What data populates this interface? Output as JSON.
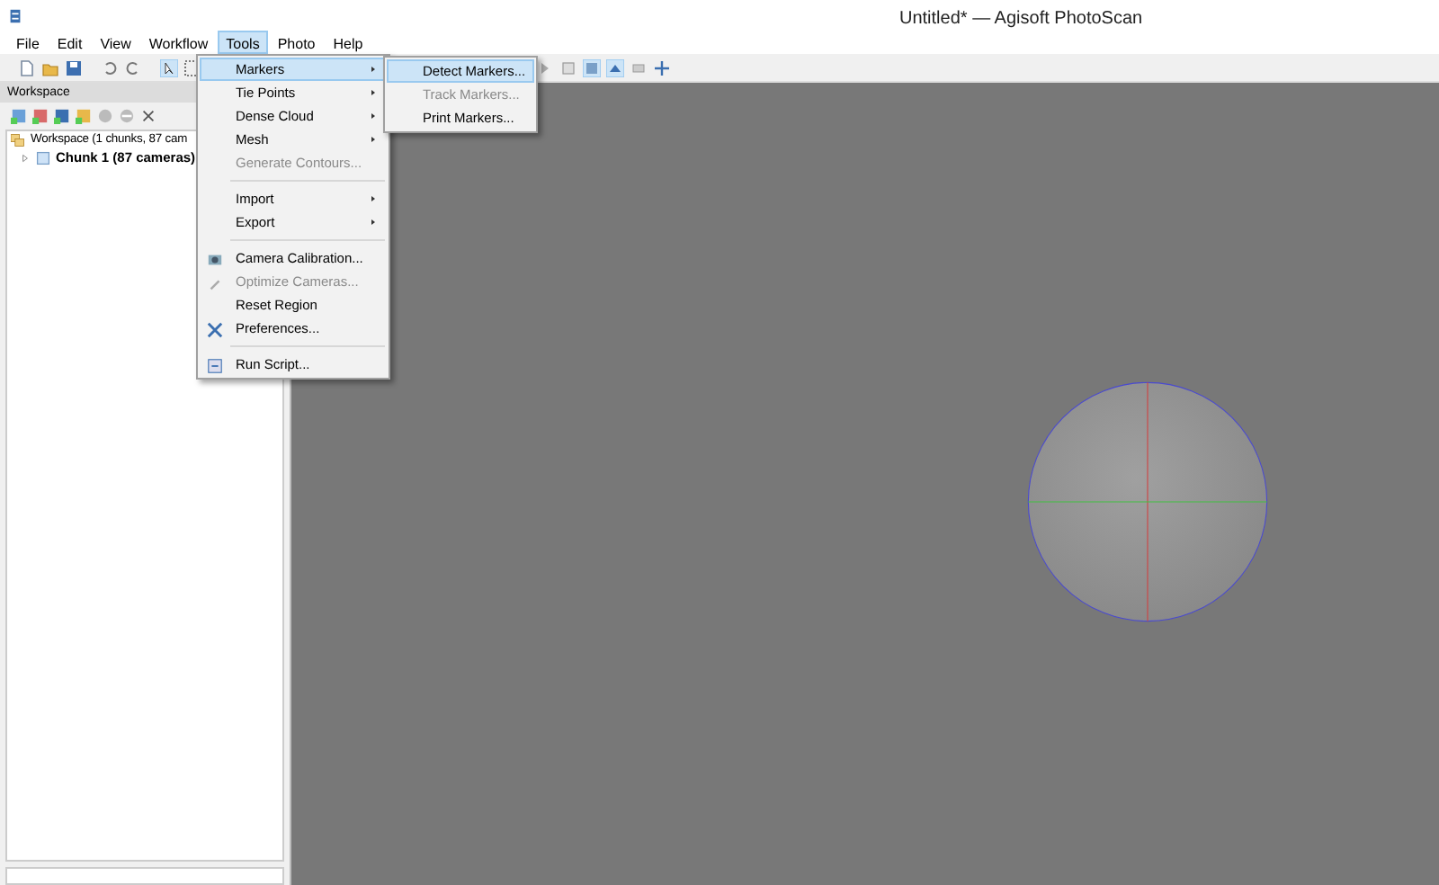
{
  "window": {
    "title": "Untitled* — Agisoft PhotoScan"
  },
  "menu_bar": [
    {
      "label": "File",
      "selected": false
    },
    {
      "label": "Edit",
      "selected": false
    },
    {
      "label": "View",
      "selected": false
    },
    {
      "label": "Workflow",
      "selected": false
    },
    {
      "label": "Tools",
      "selected": true
    },
    {
      "label": "Photo",
      "selected": false
    },
    {
      "label": "Help",
      "selected": false
    }
  ],
  "workspace": {
    "title": "Workspace",
    "tree": [
      {
        "label": "Workspace (1 chunks, 87 cam",
        "children": [
          {
            "label": "Chunk 1 (87 cameras)",
            "expanded": false
          }
        ]
      }
    ]
  },
  "tools_menu": [
    {
      "kind": "item",
      "label": "Markers",
      "submenu": true,
      "disabled": false,
      "selected": true
    },
    {
      "kind": "item",
      "label": "Tie Points",
      "submenu": true,
      "disabled": false,
      "selected": false
    },
    {
      "kind": "item",
      "label": "Dense Cloud",
      "submenu": true,
      "disabled": false,
      "selected": false
    },
    {
      "kind": "item",
      "label": "Mesh",
      "submenu": true,
      "disabled": false,
      "selected": false
    },
    {
      "kind": "item",
      "label": "Generate Contours...",
      "submenu": false,
      "disabled": true,
      "selected": false
    },
    {
      "kind": "separator"
    },
    {
      "kind": "item",
      "label": "Import",
      "submenu": true,
      "disabled": false,
      "selected": false
    },
    {
      "kind": "item",
      "label": "Export",
      "submenu": true,
      "disabled": false,
      "selected": false
    },
    {
      "kind": "separator"
    },
    {
      "kind": "item",
      "label": "Camera Calibration...",
      "submenu": false,
      "disabled": false,
      "selected": false
    },
    {
      "kind": "item",
      "label": "Optimize Cameras...",
      "submenu": false,
      "disabled": true,
      "selected": false
    },
    {
      "kind": "item",
      "label": "Reset Region",
      "submenu": false,
      "disabled": false,
      "selected": false
    },
    {
      "kind": "item",
      "label": "Preferences...",
      "submenu": false,
      "disabled": false,
      "selected": false
    },
    {
      "kind": "separator"
    },
    {
      "kind": "item",
      "label": "Run Script...",
      "submenu": false,
      "disabled": false,
      "selected": false
    }
  ],
  "markers_submenu": [
    {
      "label": "Detect Markers...",
      "disabled": false,
      "selected": true
    },
    {
      "label": "Track Markers...",
      "disabled": true,
      "selected": false
    },
    {
      "label": "Print Markers...",
      "disabled": false,
      "selected": false
    }
  ]
}
